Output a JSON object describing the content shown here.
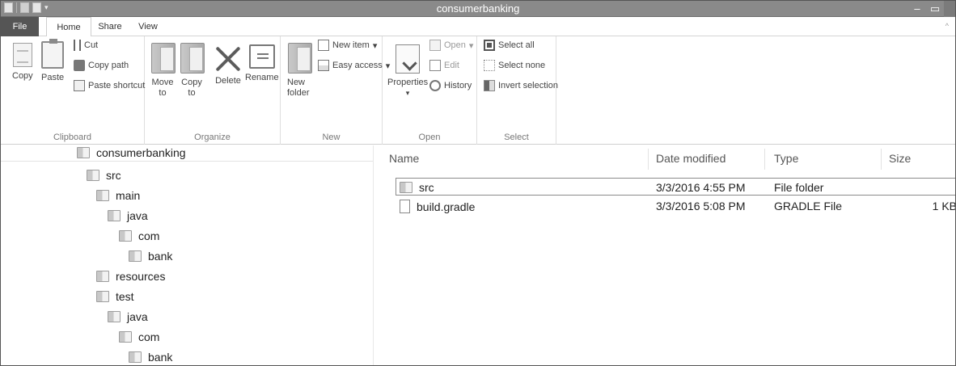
{
  "window": {
    "title": "consumerbanking"
  },
  "ribbon_tabs": [
    "File",
    "Home",
    "Share",
    "View"
  ],
  "groups": {
    "clipboard": {
      "label": "Clipboard",
      "copy": "Copy",
      "paste": "Paste",
      "cut": "Cut",
      "copy_path": "Copy path",
      "paste_shortcut": "Paste shortcut"
    },
    "organize": {
      "label": "Organize",
      "move_to": "Move to",
      "copy_to": "Copy to",
      "delete": "Delete",
      "rename": "Rename"
    },
    "new": {
      "label": "New",
      "new_folder": "New folder",
      "new_item": "New item",
      "easy_access": "Easy access"
    },
    "open": {
      "label": "Open",
      "properties": "Properties",
      "open": "Open",
      "edit": "Edit",
      "history": "History"
    },
    "select": {
      "label": "Select",
      "select_all": "Select all",
      "select_none": "Select none",
      "invert_selection": "Invert selection"
    }
  },
  "tree": [
    {
      "label": "consumerbanking"
    },
    {
      "label": "src"
    },
    {
      "label": "main"
    },
    {
      "label": "java"
    },
    {
      "label": "com"
    },
    {
      "label": "bank"
    },
    {
      "label": "resources"
    },
    {
      "label": "test"
    },
    {
      "label": "java"
    },
    {
      "label": "com"
    },
    {
      "label": "bank"
    }
  ],
  "columns": [
    "Name",
    "Date modified",
    "Type",
    "Size"
  ],
  "files": [
    {
      "name": "src",
      "date": "3/3/2016 4:55 PM",
      "type": "File folder",
      "size": "",
      "icon": "folder-icon"
    },
    {
      "name": "build.gradle",
      "date": "3/3/2016 5:08 PM",
      "type": "GRADLE File",
      "size": "1 KB",
      "icon": "file-icon"
    }
  ]
}
